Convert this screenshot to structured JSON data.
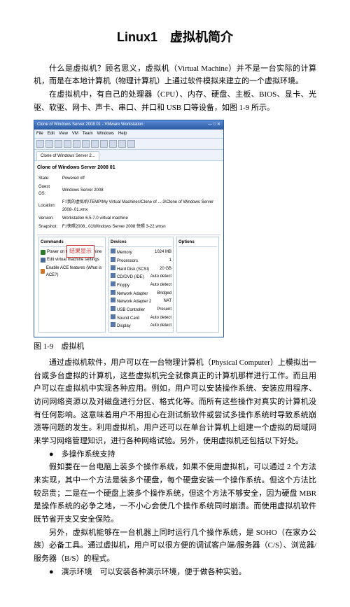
{
  "title": "Linux1　虚拟机简介",
  "para1": "什么是虚拟机？顾名思义，虚拟机（Virtual Machine）并不是一台实际的计算机，而是在本地计算机（物理计算机）上通过软件模拟来建立的一个虚拟环境。",
  "para2": "在虚拟机中，有自己的处理器（CPU）、内存、硬盘、主板、BIOS、显卡、光驱、软驱、网卡、声卡、串口、并口和 USB 口等设备，如图 1-9 所示。",
  "figure_caption": "图 1-9　虚拟机",
  "para3": "通过虚拟机软件，用户可以在一台物理计算机（Physical Computer）上模拟出一台或多台虚拟的计算机，这些虚拟机完全就像真正的计算机那样进行工作。而且用户可以在虚拟机中实现各种应用。例如，用户可以安装操作系统、安装应用程序、访问网络资源以及对磁盘进行分区、格式化等。而所有这些操作对真实的计算机没有任何影响。这意味着用户不用担心在测试新软件或尝试多操作系统时导致系统崩溃等问题的发生。利用虚拟机，用户还可以在单台计算机上组建一个虚拟的局域网来学习网络管理知识，进行各种网络试验。另外，使用虚拟机还包括以下好处。",
  "bullet1_label": "多操作系统支持",
  "para4": "假如要在一台电脑上装多个操作系统，如果不使用虚拟机，可以通过 2 个方法来实现，其中一个方法是装多个硬盘，每个硬盘安装一个操作系统。但这个方法比较昂贵；二是在一个硬盘上装多个操作系统，但这个方法不够安全，因为硬盘 MBR 是操作系统的必争之地，一不小心会使几个操作系统同时崩溃。而使用虚拟机软件既节省开支又安全保险。",
  "para5": "另外，虚拟机能够在一台机器上同时运行几个操作系统，是 SOHO（在家办公族）必备工具。通过虚拟机，用户可以很方便的调试客户端/服务器（C/S）、浏览器/服务器（B/S）的程式。",
  "bullet2_label": "演示环境",
  "bullet2_text": "可以安装各种演示环境，便于做各种实验。",
  "vm": {
    "titlebar": "Clone of Windows Server 2008  01 -  VMware Workstation",
    "menu": [
      "File",
      "Edit",
      "View",
      "VM",
      "Team",
      "Windows",
      "Help"
    ],
    "tab": "Clone of Windows Server 2...",
    "heading": "Clone of Windows Server 2008  01",
    "meta": {
      "state_k": "State:",
      "state_v": "Powered off",
      "os_k": "Guest OS:",
      "os_v": "Windows Server 2008",
      "loc_k": "Location:",
      "loc_v": "F:\\我的虚拟机\\TEMP\\My Virtual Machines\\Clone of ...-3\\Clone of Windows Server 2008-.01.vmx",
      "ver_k": "Version:",
      "ver_v": "Workstation 6.5-7.0 virtual machine",
      "snap_k": "Snapshot:",
      "snap_v": "F:\\快照2008...01\\Windows Server 2008 快照 3-22.vmsn"
    },
    "commands_hdr": "Commands",
    "commands": [
      "Power on this virtual machine",
      "Edit virtual machine settings",
      "Enable ACE features (What is ACE?)"
    ],
    "callout": "结果显示",
    "devices_hdr": "Devices",
    "devices": [
      {
        "k": "Memory",
        "v": "1024 MB"
      },
      {
        "k": "Processors",
        "v": "1"
      },
      {
        "k": "Hard Disk (SCSI)",
        "v": "20 GB"
      },
      {
        "k": "CD/DVD (IDE)",
        "v": "Auto detect"
      },
      {
        "k": "Floppy",
        "v": "Auto detect"
      },
      {
        "k": "Network Adapter",
        "v": "Bridged"
      },
      {
        "k": "Network Adapter 2",
        "v": "NAT"
      },
      {
        "k": "USB Controller",
        "v": "Present"
      },
      {
        "k": "Sound Card",
        "v": "Auto detect"
      },
      {
        "k": "Display",
        "v": "Auto detect"
      }
    ],
    "options_hdr": "Options"
  }
}
